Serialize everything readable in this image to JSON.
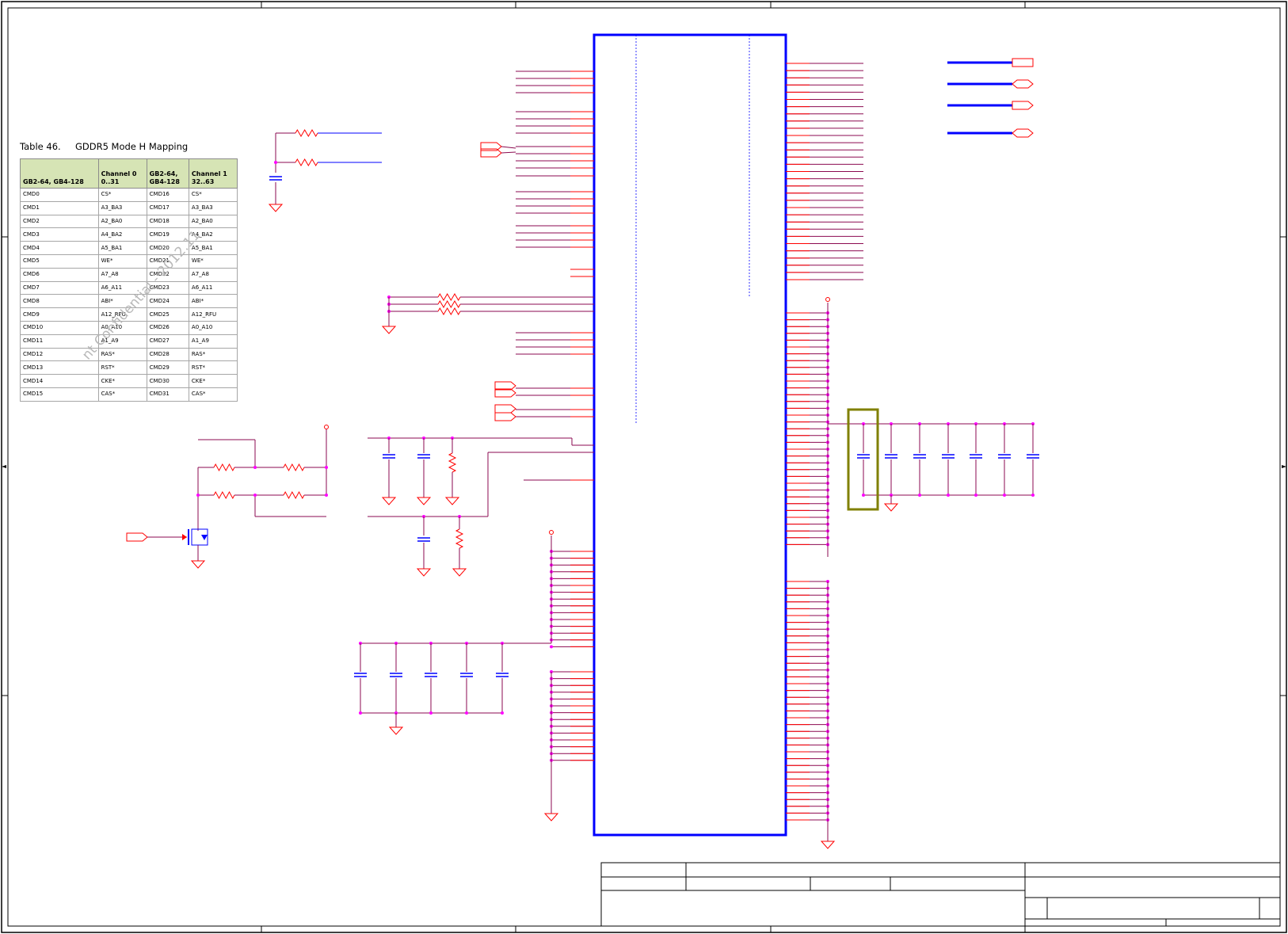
{
  "caption": {
    "number": "Table 46.",
    "title": "GDDR5 Mode H Mapping"
  },
  "mapping_table": {
    "headers": [
      "GB2-64, GB4-128",
      "Channel 0 0..31",
      "GB2-64, GB4-128",
      "Channel 1 32..63"
    ],
    "header_lines": [
      [
        "",
        "GB2-64, GB4-128"
      ],
      [
        "Channel 0",
        "0..31"
      ],
      [
        "GB2-64,",
        "GB4-128"
      ],
      [
        "Channel 1",
        "32..63"
      ]
    ],
    "rows": [
      [
        "CMD0",
        "CS*",
        "CMD16",
        "CS*"
      ],
      [
        "CMD1",
        "A3_BA3",
        "CMD17",
        "A3_BA3"
      ],
      [
        "CMD2",
        "A2_BA0",
        "CMD18",
        "A2_BA0"
      ],
      [
        "CMD3",
        "A4_BA2",
        "CMD19",
        "A4_BA2"
      ],
      [
        "CMD4",
        "A5_BA1",
        "CMD20",
        "A5_BA1"
      ],
      [
        "CMD5",
        "WE*",
        "CMD21",
        "WE*"
      ],
      [
        "CMD6",
        "A7_A8",
        "CMD22",
        "A7_A8"
      ],
      [
        "CMD7",
        "A6_A11",
        "CMD23",
        "A6_A11"
      ],
      [
        "CMD8",
        "ABI*",
        "CMD24",
        "ABI*"
      ],
      [
        "CMD9",
        "A12_RFU",
        "CMD25",
        "A12_RFU"
      ],
      [
        "CMD10",
        "A0_A10",
        "CMD26",
        "A0_A10"
      ],
      [
        "CMD11",
        "A1_A9",
        "CMD27",
        "A1_A9"
      ],
      [
        "CMD12",
        "RAS*",
        "CMD28",
        "RAS*"
      ],
      [
        "CMD13",
        "RST*",
        "CMD29",
        "RST*"
      ],
      [
        "CMD14",
        "CKE*",
        "CMD30",
        "CKE*"
      ],
      [
        "CMD15",
        "CAS*",
        "CMD31",
        "CAS*"
      ]
    ]
  },
  "watermark": "nt Confidential - 2012.11",
  "colors": {
    "border": "#000000",
    "net": "#8b0a50",
    "pin": "#ff0000",
    "part": "#0000ff",
    "junction": "#ff00ff",
    "highlight": "#808000",
    "table_header": "#d6e4b5"
  }
}
